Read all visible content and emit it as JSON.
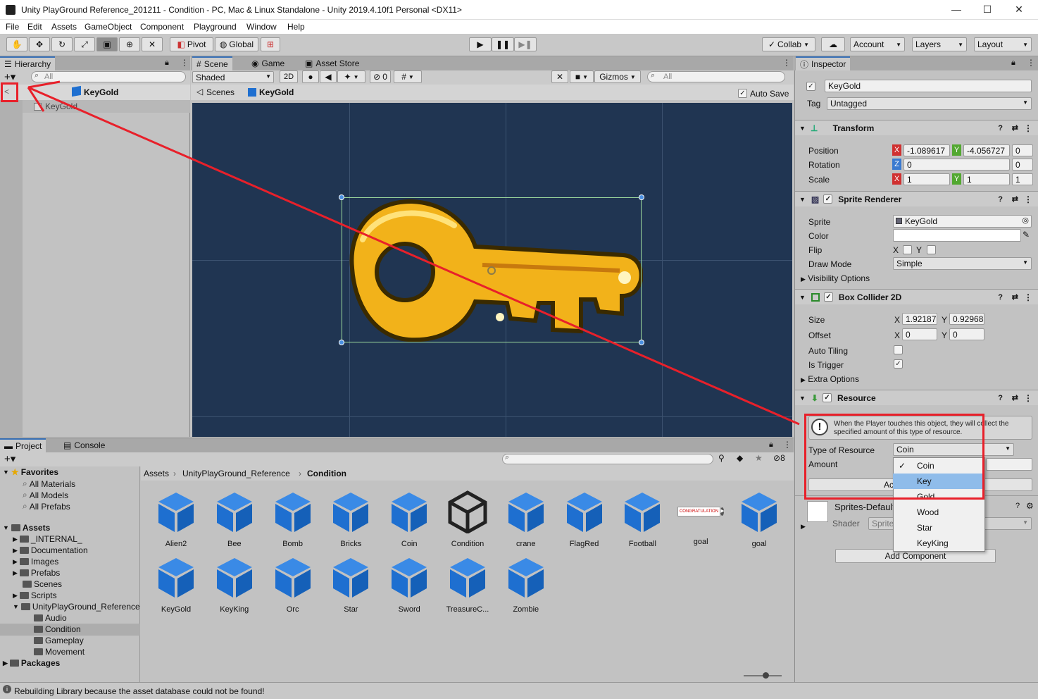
{
  "window": {
    "title": "Unity PlayGround Reference_201211 - Condition - PC, Mac & Linux Standalone - Unity 2019.4.10f1 Personal <DX11>",
    "minimize": "—",
    "maximize": "☐",
    "close": "✕"
  },
  "menu": [
    "File",
    "Edit",
    "Assets",
    "GameObject",
    "Component",
    "Playground",
    "Window",
    "Help"
  ],
  "toolbar": {
    "pivot": "Pivot",
    "global": "Global",
    "collab": "Collab",
    "account": "Account",
    "layers": "Layers",
    "layout": "Layout",
    "play": "▶",
    "pause": "❚❚",
    "step": "▶❚"
  },
  "hierarchy": {
    "tab": "Hierarchy",
    "search_placeholder": "All",
    "prefab_name": "KeyGold",
    "item": "KeyGold",
    "back": "<"
  },
  "scene": {
    "tabs": [
      "Scene",
      "Game",
      "Asset Store"
    ],
    "shading": "Shaded",
    "mode2d": "2D",
    "hidden_count": "0",
    "gizmos": "Gizmos",
    "search_placeholder": "All",
    "breadcrumb_scenes": "Scenes",
    "breadcrumb_object": "KeyGold",
    "autosave": "Auto Save"
  },
  "inspector": {
    "tab": "Inspector",
    "object_name": "KeyGold",
    "tag_label": "Tag",
    "tag_value": "Untagged",
    "transform": {
      "title": "Transform",
      "position_label": "Position",
      "rotation_label": "Rotation",
      "scale_label": "Scale",
      "pos_x": "-1.089617",
      "pos_y": "-4.056727",
      "pos_z": "0",
      "rot_x": "",
      "rot_z": "0",
      "rot_last": "0",
      "scale_x": "1",
      "scale_y": "1",
      "scale_z": "1"
    },
    "sprite_renderer": {
      "title": "Sprite Renderer",
      "sprite_label": "Sprite",
      "sprite_value": "KeyGold",
      "color_label": "Color",
      "flip_label": "Flip",
      "flip_x": "X",
      "flip_y": "Y",
      "draw_mode_label": "Draw Mode",
      "draw_mode_value": "Simple",
      "visibility": "Visibility Options"
    },
    "box_collider": {
      "title": "Box Collider 2D",
      "size_label": "Size",
      "size_x": "1.921875",
      "size_y": "0.929688",
      "offset_label": "Offset",
      "offset_x": "0",
      "offset_y": "0",
      "auto_tiling": "Auto Tiling",
      "is_trigger": "Is Trigger",
      "extra": "Extra Options",
      "x": "X",
      "y": "Y"
    },
    "resource": {
      "title": "Resource",
      "info": "When the Player touches this object, they will collect the specified amount of this type of resource.",
      "type_label": "Type of Resource",
      "type_value": "Coin",
      "amount_label": "Amount",
      "add_partial": "Ac"
    },
    "material": {
      "name": "Sprites-Default",
      "shader_label": "Shader",
      "shader_value": "Sprite"
    },
    "add_component": "Add Component"
  },
  "dropdown": {
    "options": [
      "Coin",
      "Key",
      "Gold",
      "Wood",
      "Star",
      "KeyKing"
    ],
    "checked": "Coin",
    "highlighted": "Key"
  },
  "project": {
    "tabs": [
      "Project",
      "Console"
    ],
    "hidden_count": "8",
    "breadcrumb": [
      "Assets",
      "UnityPlayGround_Reference",
      "Condition"
    ],
    "favorites": {
      "title": "Favorites",
      "items": [
        "All Materials",
        "All Models",
        "All Prefabs"
      ]
    },
    "assets_title": "Assets",
    "tree": [
      "_INTERNAL_",
      "Documentation",
      "Images",
      "Prefabs",
      "Scenes",
      "Scripts",
      "UnityPlayGround_Reference"
    ],
    "subtree": [
      "Audio",
      "Condition",
      "Gameplay",
      "Movement"
    ],
    "packages": "Packages",
    "grid": [
      "Alien2",
      "Bee",
      "Bomb",
      "Bricks",
      "Coin",
      "Condition",
      "crane",
      "FlagRed",
      "Football",
      "goal",
      "goal",
      "KeyGold",
      "KeyKing",
      "Orc",
      "Star",
      "Sword",
      "TreasureC...",
      "Zombie"
    ],
    "banner_text": "CONGRATULATION"
  },
  "status": "Rebuilding Library because the asset database could not be found!",
  "colors": {
    "scene_bg": "#203552",
    "key_gold": "#f2b21a",
    "annotation_red": "#e8202a",
    "selection_blue": "#8fbcea"
  }
}
